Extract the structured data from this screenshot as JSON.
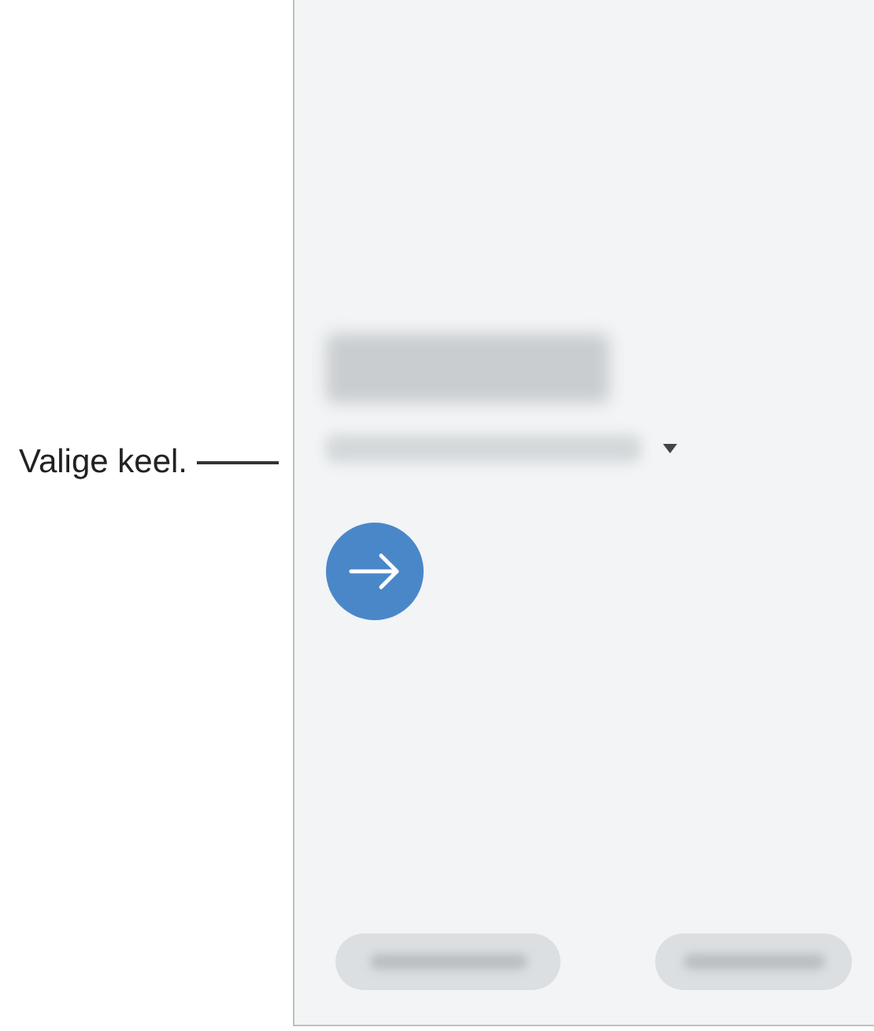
{
  "callout": {
    "label": "Valige keel."
  }
}
